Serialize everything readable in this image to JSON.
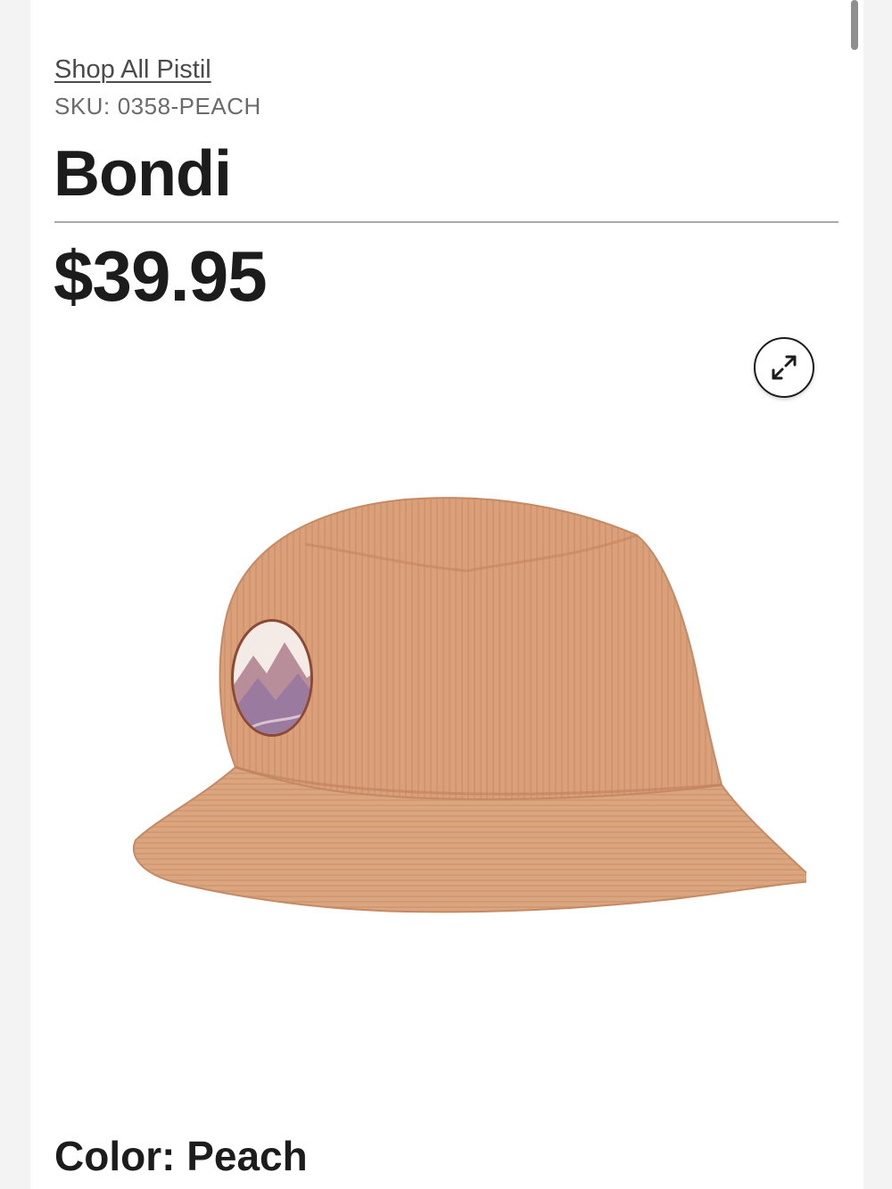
{
  "breadcrumb": {
    "link_label": "Shop All Pistil"
  },
  "product": {
    "sku_label": "SKU:",
    "sku_value": "0358-PEACH",
    "title": "Bondi",
    "price": "$39.95",
    "image_alt": "Bondi peach corduroy bucket hat",
    "color_label": "Color:",
    "color_value": "Peach"
  },
  "icons": {
    "expand": "expand-arrows-icon"
  },
  "colors": {
    "text": "#1c1c1c",
    "muted_text": "#6b6b6b",
    "hat_peach": "#d9a07a",
    "patch_outline": "#8a4a34",
    "background": "#ffffff"
  }
}
